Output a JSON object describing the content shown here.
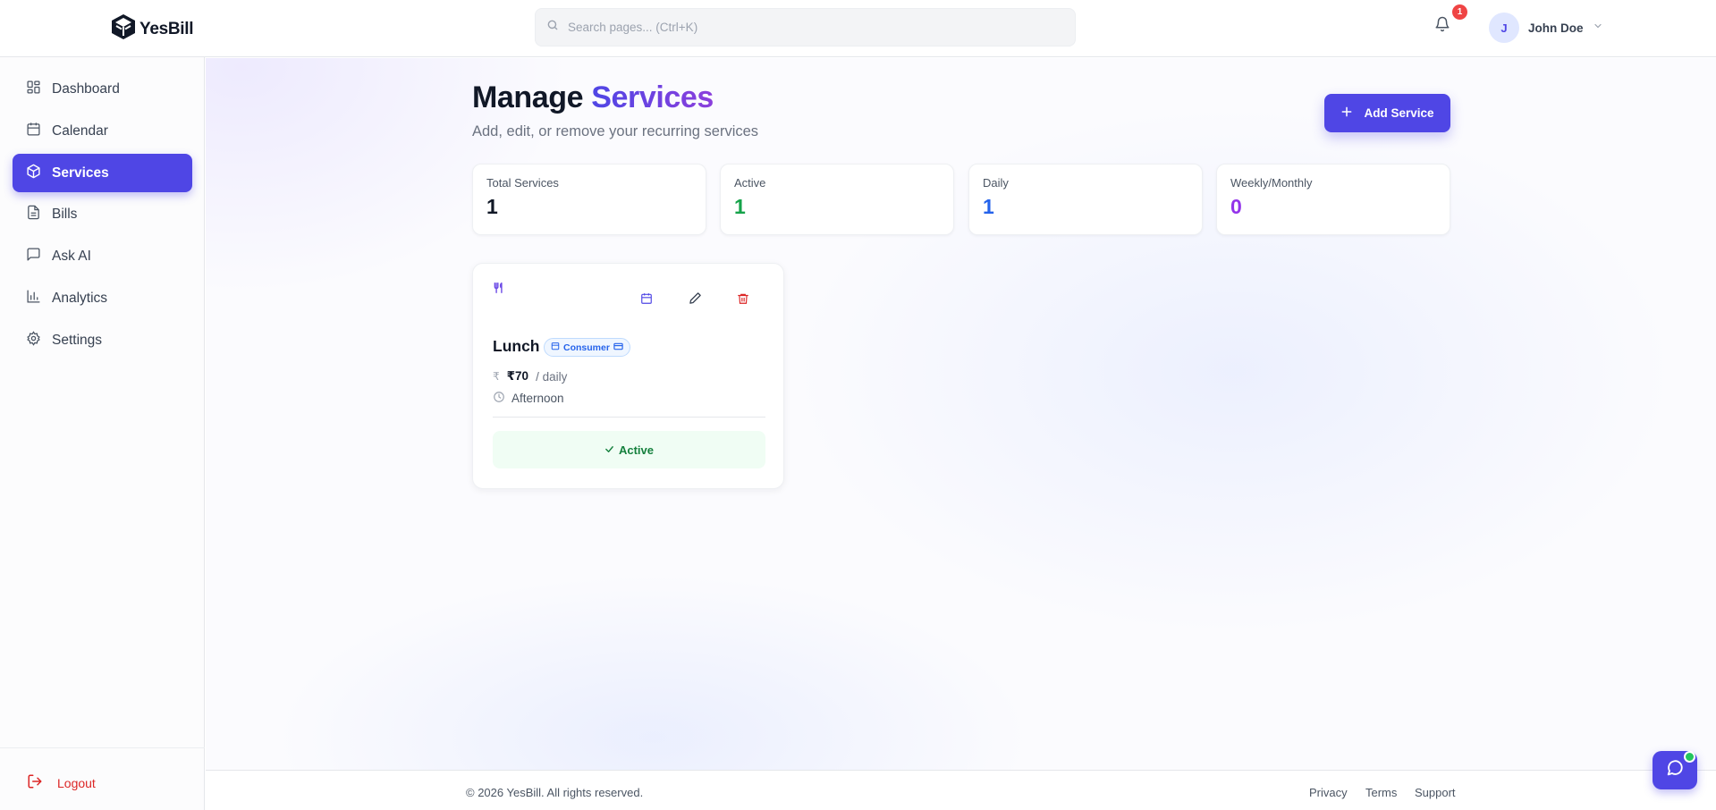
{
  "app": {
    "name": "YesBill"
  },
  "search": {
    "placeholder": "Search pages... (Ctrl+K)",
    "value": ""
  },
  "notifications": {
    "count": "1"
  },
  "user": {
    "initial": "J",
    "name": "John Doe"
  },
  "sidebar": {
    "items": [
      {
        "label": "Dashboard",
        "icon": "dashboard-icon"
      },
      {
        "label": "Calendar",
        "icon": "calendar-icon"
      },
      {
        "label": "Services",
        "icon": "package-icon",
        "active": true
      },
      {
        "label": "Bills",
        "icon": "file-text-icon"
      },
      {
        "label": "Ask AI",
        "icon": "message-square-icon"
      },
      {
        "label": "Analytics",
        "icon": "bar-chart-icon"
      },
      {
        "label": "Settings",
        "icon": "gear-icon"
      }
    ],
    "logout_label": "Logout"
  },
  "page": {
    "title_main": "Manage",
    "title_accent": "Services",
    "subtitle": "Add, edit, or remove your recurring services",
    "add_button_label": "Add Service"
  },
  "stats": [
    {
      "label": "Total Services",
      "value": "1",
      "color": "#111827"
    },
    {
      "label": "Active",
      "value": "1",
      "color": "#16a34a"
    },
    {
      "label": "Daily",
      "value": "1",
      "color": "#2563eb"
    },
    {
      "label": "Weekly/Monthly",
      "value": "0",
      "color": "#9333ea"
    }
  ],
  "services": [
    {
      "name": "Lunch",
      "role_badge": "Consumer",
      "currency_symbol": "₹",
      "price": "₹70",
      "frequency": "/ daily",
      "time": "Afternoon",
      "status": "Active",
      "icon": "utensils-icon"
    }
  ],
  "footer": {
    "copyright": "© 2026 YesBill. All rights reserved.",
    "links": [
      "Privacy",
      "Terms",
      "Support"
    ]
  },
  "colors": {
    "accent": "#4f46e5",
    "danger": "#dc2626",
    "success": "#15803d"
  }
}
